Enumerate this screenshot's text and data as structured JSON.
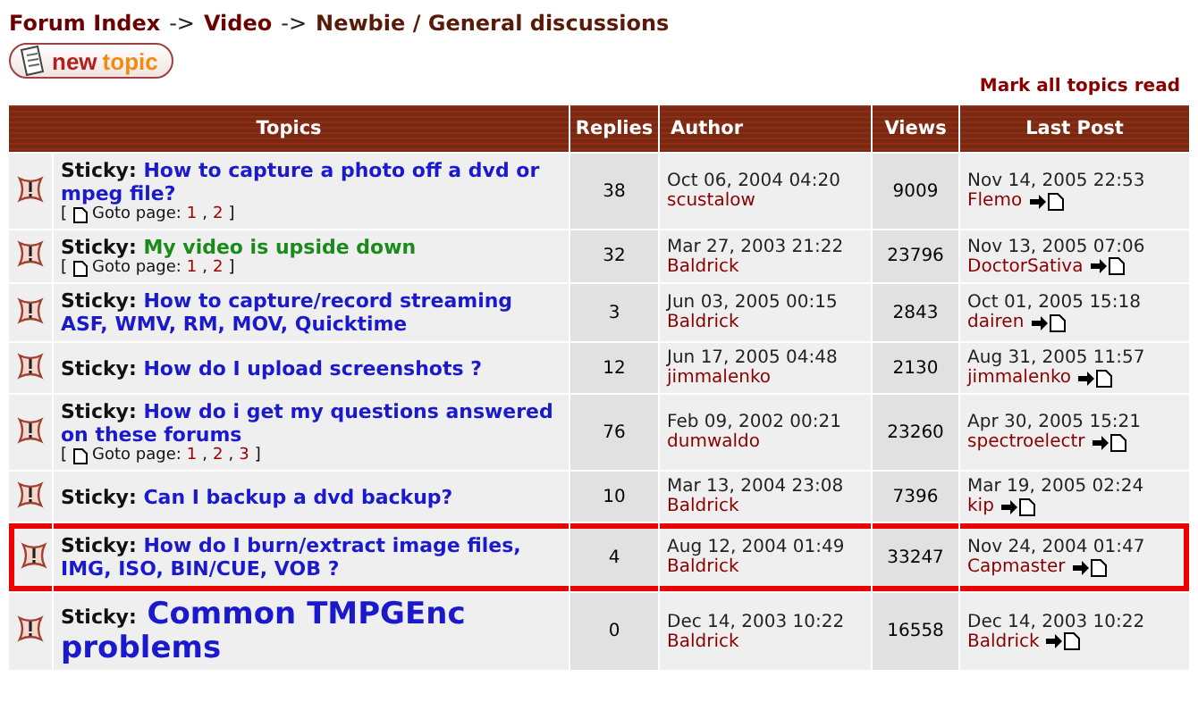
{
  "breadcrumb": [
    {
      "label": "Forum Index"
    },
    {
      "label": "->",
      "kind": "sep"
    },
    {
      "label": "Video"
    },
    {
      "label": "->",
      "kind": "sep"
    },
    {
      "label": "Newbie / General discussions"
    }
  ],
  "new_topic_button": {
    "label_1": "new",
    "label_2": "topic"
  },
  "mark_read_link": "Mark all topics read",
  "table": {
    "columns": [
      "Topics",
      "Replies",
      "Author",
      "Views",
      "Last Post"
    ],
    "rows": [
      {
        "prefix": "Sticky:",
        "title": "How to capture a photo off a dvd or mpeg file?",
        "color": "#1a1acc",
        "kind": "normal",
        "goto": {
          "open": "[",
          "label": "Goto page:",
          "pages": [
            {
              "label": "1",
              "sep": ","
            },
            {
              "label": "2"
            }
          ],
          "close": "]"
        },
        "replies": "38",
        "author_date": "Oct 06, 2004 04:20",
        "author": "scustalow",
        "views": "9009",
        "last_date": "Nov 14, 2005 22:53",
        "last_user": "Flemo",
        "highlighted": false
      },
      {
        "prefix": "Sticky:",
        "title": "My video is upside down",
        "color": "#1a8a1a",
        "kind": "normal",
        "goto": {
          "open": "[",
          "label": "Goto page:",
          "pages": [
            {
              "label": "1",
              "sep": ","
            },
            {
              "label": "2"
            }
          ],
          "close": "]"
        },
        "replies": "32",
        "author_date": "Mar 27, 2003 21:22",
        "author": "Baldrick",
        "views": "23796",
        "last_date": "Nov 13, 2005 07:06",
        "last_user": "DoctorSativa",
        "highlighted": false
      },
      {
        "prefix": "Sticky:",
        "title": "How to capture/record streaming ASF, WMV, RM, MOV, Quicktime",
        "color": "#1a1acc",
        "kind": "normal",
        "replies": "3",
        "author_date": "Jun 03, 2005 00:15",
        "author": "Baldrick",
        "views": "2843",
        "last_date": "Oct 01, 2005 15:18",
        "last_user": "dairen",
        "highlighted": false
      },
      {
        "prefix": "Sticky:",
        "title": "How do I upload screenshots ?",
        "color": "#1a1acc",
        "kind": "normal",
        "replies": "12",
        "author_date": "Jun 17, 2005 04:48",
        "author": "jimmalenko",
        "views": "2130",
        "last_date": "Aug 31, 2005 11:57",
        "last_user": "jimmalenko",
        "highlighted": false
      },
      {
        "prefix": "Sticky:",
        "title": "How do i get my questions answered on these forums",
        "color": "#1a1acc",
        "kind": "normal",
        "goto": {
          "open": "[",
          "label": "Goto page:",
          "pages": [
            {
              "label": "1",
              "sep": ","
            },
            {
              "label": "2",
              "sep": ","
            },
            {
              "label": "3"
            }
          ],
          "close": "]"
        },
        "replies": "76",
        "author_date": "Feb 09, 2002 00:21",
        "author": "dumwaldo",
        "views": "23260",
        "last_date": "Apr 30, 2005 15:21",
        "last_user": "spectroelectr",
        "highlighted": false
      },
      {
        "prefix": "Sticky:",
        "title": "Can I backup a dvd backup?",
        "color": "#1a1acc",
        "kind": "normal",
        "replies": "10",
        "author_date": "Mar 13, 2004 23:08",
        "author": "Baldrick",
        "views": "7396",
        "last_date": "Mar 19, 2005 02:24",
        "last_user": "kip",
        "highlighted": false
      },
      {
        "prefix": "Sticky:",
        "title": "How do I burn/extract image files, IMG, ISO, BIN/CUE, VOB ?",
        "color": "#1a1acc",
        "kind": "normal",
        "replies": "4",
        "author_date": "Aug 12, 2004 01:49",
        "author": "Baldrick",
        "views": "33247",
        "last_date": "Nov 24, 2004 01:47",
        "last_user": "Capmaster",
        "highlighted": true
      },
      {
        "prefix": "Sticky:",
        "title": "Common TMPGEnc problems",
        "color": "#1a1acc",
        "kind": "large",
        "replies": "0",
        "author_date": "Dec 14, 2003 10:22",
        "author": "Baldrick",
        "views": "16558",
        "last_date": "Dec 14, 2003 10:22",
        "last_user": "Baldrick",
        "highlighted": false
      }
    ]
  }
}
